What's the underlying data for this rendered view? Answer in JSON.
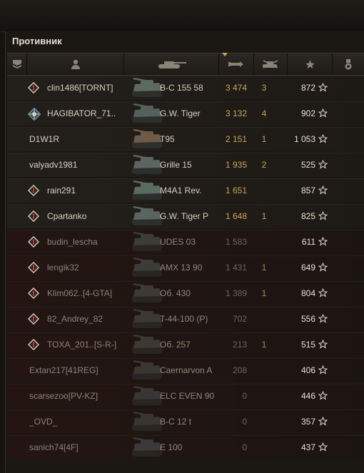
{
  "panel": {
    "title": "Противник",
    "header_icons": [
      "platoon-icon",
      "player-icon",
      "tank-icon",
      "sort-arrow-icon",
      "damage-icon",
      "kills-icon",
      "experience-star-icon",
      "medal-icon"
    ]
  },
  "players": [
    {
      "name": "clin1486[TORNT]",
      "tank": "В-С 155 58",
      "damage": "3 474",
      "kills": "3",
      "xp": "872",
      "rank": true,
      "alive": true
    },
    {
      "name": "HAGIBATOR_71..",
      "tank": "G.W. Tiger",
      "damage": "3 132",
      "kills": "4",
      "xp": "902",
      "rank": true,
      "special": true,
      "alive": true
    },
    {
      "name": "D1W1R",
      "tank": "T95",
      "damage": "2 151",
      "kills": "1",
      "xp": "1 053",
      "rank": false,
      "alive": true
    },
    {
      "name": "valyadv1981",
      "tank": "Grille 15",
      "damage": "1 935",
      "kills": "2",
      "xp": "525",
      "rank": false,
      "alive": true
    },
    {
      "name": "rain291",
      "tank": "M4A1 Rev.",
      "damage": "1 651",
      "kills": "",
      "xp": "857",
      "rank": true,
      "alive": true
    },
    {
      "name": "Cpartanko",
      "tank": "G.W. Tiger P",
      "damage": "1 648",
      "kills": "1",
      "xp": "825",
      "rank": true,
      "alive": true
    },
    {
      "name": "budin_lescha",
      "tank": "UDES 03",
      "damage": "1 583",
      "kills": "",
      "xp": "611",
      "rank": true,
      "alive": false
    },
    {
      "name": "lengik32",
      "tank": "AMX 13 90",
      "damage": "1 431",
      "kills": "1",
      "xp": "649",
      "rank": true,
      "alive": false
    },
    {
      "name": "Klim062..[4-GTA]",
      "tank": "Об. 430",
      "damage": "1 389",
      "kills": "1",
      "xp": "804",
      "rank": true,
      "alive": false
    },
    {
      "name": "82_Andrey_82",
      "tank": "T-44-100 (P)",
      "damage": "702",
      "kills": "",
      "xp": "556",
      "rank": true,
      "alive": false
    },
    {
      "name": "TOXA_201..[S-R-]",
      "tank": "Об. 257",
      "damage": "213",
      "kills": "1",
      "xp": "515",
      "rank": true,
      "alive": false
    },
    {
      "name": "Extan217[41REG]",
      "tank": "Caernarvon A",
      "damage": "208",
      "kills": "",
      "xp": "406",
      "rank": false,
      "alive": false
    },
    {
      "name": "scarsezoo[PV-KZ]",
      "tank": "ELC EVEN 90",
      "damage": "0",
      "kills": "",
      "xp": "446",
      "rank": false,
      "alive": false
    },
    {
      "name": "_OVD_",
      "tank": "В-С 12 t",
      "damage": "0",
      "kills": "",
      "xp": "357",
      "rank": false,
      "alive": false
    },
    {
      "name": "sanich74[4F]",
      "tank": "E 100",
      "damage": "0",
      "kills": "",
      "xp": "437",
      "rank": false,
      "alive": false
    }
  ]
}
